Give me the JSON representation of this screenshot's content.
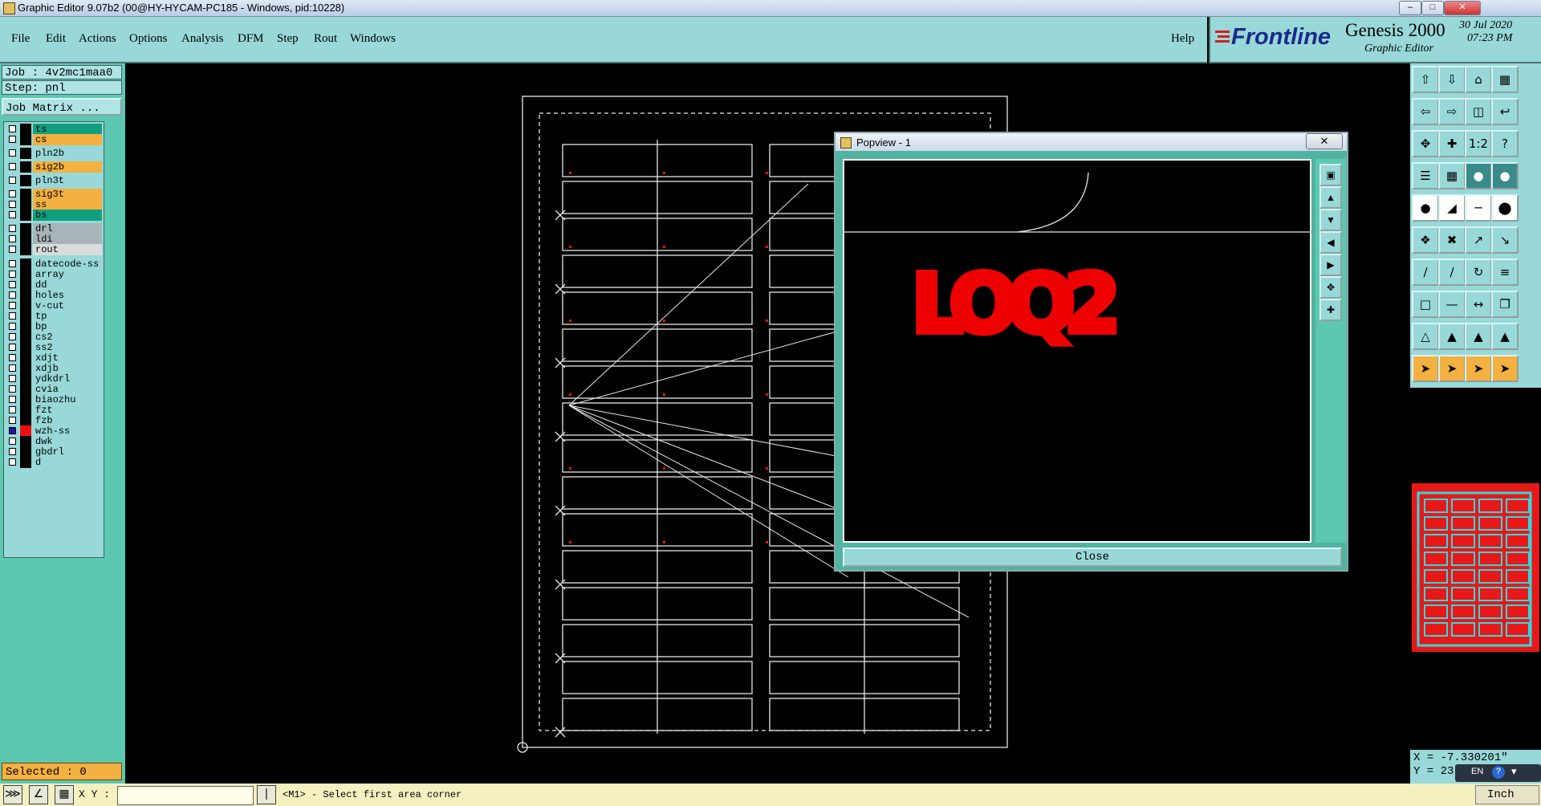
{
  "window": {
    "title": "Graphic Editor 9.07b2 (00@HY-HYCAM-PC185 - Windows, pid:10228)"
  },
  "menu": [
    "File",
    "Edit",
    "Actions",
    "Options",
    "Analysis",
    "DFM",
    "Step",
    "Rout",
    "Windows"
  ],
  "help": "Help",
  "brand": {
    "logo": "Frontline",
    "product": "Genesis 2000",
    "subtitle": "Graphic Editor",
    "date": "30 Jul 2020",
    "time": "07:23 PM"
  },
  "job": {
    "job_label": "Job : 4v2mc1maa0",
    "step_label": "Step: pnl",
    "matrix_button": "Job Matrix ..."
  },
  "layers": [
    {
      "name": "ts",
      "color": "#10a080"
    },
    {
      "name": "cs",
      "color": "#f4b040"
    },
    {
      "name": "pln2b",
      "color": "#98d8d8"
    },
    {
      "name": "sig2b",
      "color": "#f4b040"
    },
    {
      "name": "pln3t",
      "color": "#98d8d8"
    },
    {
      "name": "sig3t",
      "color": "#f4b040"
    },
    {
      "name": "ss",
      "color": "#f4b040"
    },
    {
      "name": "bs",
      "color": "#10a080"
    },
    {
      "name": "drl",
      "color": "#a8b4b8"
    },
    {
      "name": "ldi",
      "color": "#a8b4b8"
    },
    {
      "name": "rout",
      "color": "#d8dcdc"
    },
    {
      "name": "datecode-ss",
      "color": "#98d8d8"
    },
    {
      "name": "array",
      "color": "#98d8d8"
    },
    {
      "name": "dd",
      "color": "#98d8d8"
    },
    {
      "name": "holes",
      "color": "#98d8d8"
    },
    {
      "name": "v-cut",
      "color": "#98d8d8"
    },
    {
      "name": "tp",
      "color": "#98d8d8"
    },
    {
      "name": "bp",
      "color": "#98d8d8"
    },
    {
      "name": "cs2",
      "color": "#98d8d8"
    },
    {
      "name": "ss2",
      "color": "#98d8d8"
    },
    {
      "name": "xdjt",
      "color": "#98d8d8"
    },
    {
      "name": "xdjb",
      "color": "#98d8d8"
    },
    {
      "name": "ydkdrl",
      "color": "#98d8d8"
    },
    {
      "name": "cvia",
      "color": "#98d8d8"
    },
    {
      "name": "biaozhu",
      "color": "#98d8d8"
    },
    {
      "name": "fzt",
      "color": "#98d8d8"
    },
    {
      "name": "fzb",
      "color": "#98d8d8"
    },
    {
      "name": "wzh-ss",
      "color": "#98d8d8",
      "active": true
    },
    {
      "name": "dwk",
      "color": "#98d8d8"
    },
    {
      "name": "gbdrl",
      "color": "#98d8d8"
    },
    {
      "name": "d",
      "color": "#98d8d8"
    }
  ],
  "selected": "Selected : 0",
  "status": {
    "xy_label": "X Y :",
    "xy_value": "",
    "prompt": "<M1> - Select first area corner",
    "units": "Inch"
  },
  "coords": {
    "x": "X = -7.330201\"",
    "y": "Y = 23"
  },
  "tray": {
    "lang": "EN"
  },
  "popview": {
    "title": "Popview - 1",
    "close_label": "Close",
    "text_feature": "LOQ2"
  }
}
